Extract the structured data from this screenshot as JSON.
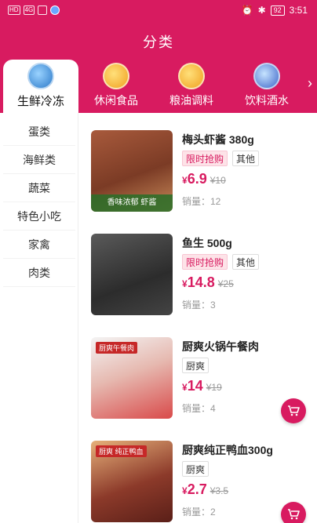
{
  "status": {
    "net1": "HD",
    "net2": "4G",
    "battery": "92",
    "time": "3:51"
  },
  "header": {
    "title": "分类"
  },
  "categories": [
    {
      "label": "生鲜冷冻",
      "icon": "seafood-icon",
      "active": true
    },
    {
      "label": "休闲食品",
      "icon": "snack-icon",
      "active": false
    },
    {
      "label": "粮油调料",
      "icon": "oil-icon",
      "active": false
    },
    {
      "label": "饮料酒水",
      "icon": "drink-icon",
      "active": false
    }
  ],
  "subcategories": [
    "蛋类",
    "海鲜类",
    "蔬菜",
    "特色小吃",
    "家禽",
    "肉类"
  ],
  "products": [
    {
      "name": "梅头虾酱 380g",
      "badges": [
        "限时抢购",
        "其他"
      ],
      "currency": "¥",
      "price": "6.9",
      "old_price": "¥10",
      "sales": "销量：12",
      "thumb_banner": "香味浓郁 虾酱",
      "thumb_tag": ""
    },
    {
      "name": "鱼生 500g",
      "badges": [
        "限时抢购",
        "其他"
      ],
      "currency": "¥",
      "price": "14.8",
      "old_price": "¥25",
      "sales": "销量：3",
      "thumb_banner": "",
      "thumb_tag": ""
    },
    {
      "name": "厨爽火锅午餐肉",
      "badges": [
        "厨爽"
      ],
      "currency": "¥",
      "price": "14",
      "old_price": "¥19",
      "sales": "销量：4",
      "thumb_banner": "",
      "thumb_tag": "厨爽午餐肉"
    },
    {
      "name": "厨爽纯正鸭血300g",
      "badges": [
        "厨爽"
      ],
      "currency": "¥",
      "price": "2.7",
      "old_price": "¥3.5",
      "sales": "销量：2",
      "thumb_banner": "",
      "thumb_tag": "厨爽 纯正鸭血"
    }
  ],
  "colors": {
    "accent": "#d81b60",
    "flash_bg": "#fde3e8"
  }
}
